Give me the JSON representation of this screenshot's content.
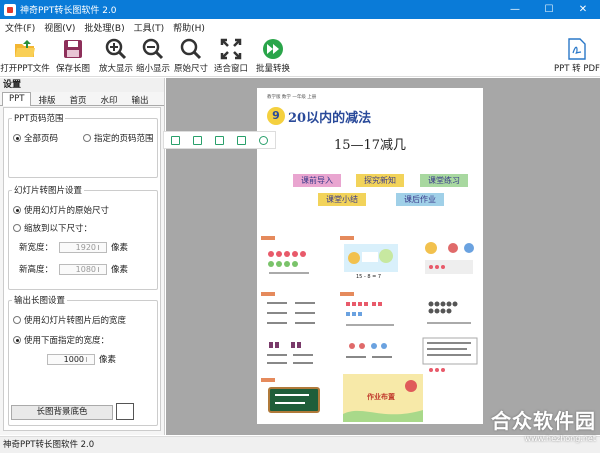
{
  "window": {
    "title": "神奇PPT转长图软件 2.0"
  },
  "menu": [
    "文件(F)",
    "视图(V)",
    "批处理(B)",
    "工具(T)",
    "帮助(H)"
  ],
  "toolbar": {
    "open": "打开PPT文件",
    "save": "保存长图",
    "zoom_in": "放大显示",
    "zoom_out": "缩小显示",
    "original": "原始尺寸",
    "fit": "适合窗口",
    "batch": "批量转换",
    "ppt_to_pdf": "PPT 转 PDF"
  },
  "sidebar": {
    "header": "设置",
    "tabs": [
      "PPT",
      "排版",
      "首页",
      "水印",
      "输出"
    ],
    "page_range": {
      "title": "PPT页码范围",
      "all": "全部页码",
      "specified": "指定的页码范围"
    },
    "slide_to_image": {
      "title": "幻灯片转图片设置",
      "original_size": "使用幻灯片的原始尺寸",
      "scale_to": "缩放到以下尺寸：",
      "width_label": "新宽度：",
      "width_value": "1920",
      "height_label": "新高度：",
      "height_value": "1080",
      "unit": "像素"
    },
    "output_image": {
      "title": "输出长图设置",
      "use_width": "使用幻灯片转图片后的宽度",
      "use_custom": "使用下面指定的宽度：",
      "width_value": "1000",
      "unit": "像素",
      "bg_button": "长图背景底色"
    }
  },
  "doc": {
    "header_small": "教学版 数学 一年级 上册",
    "chapter_no": "9",
    "chapter_title": "20以内的减法",
    "subtitle": "15—17减几",
    "buttons": [
      "课前导入",
      "探究新知",
      "课堂练习",
      "课堂小结",
      "课后作业"
    ],
    "formula": "15 - 8 = 7",
    "footer_title": "作业布置"
  },
  "status": {
    "text": "神奇PPT转长图软件 2.0"
  },
  "watermark": {
    "name": "合众软件园",
    "url": "www.hezhong.net"
  },
  "colors": {
    "titlebar": "#0a7bd8",
    "canvas": "#a7a7a7",
    "accent_green": "#29a06b"
  }
}
